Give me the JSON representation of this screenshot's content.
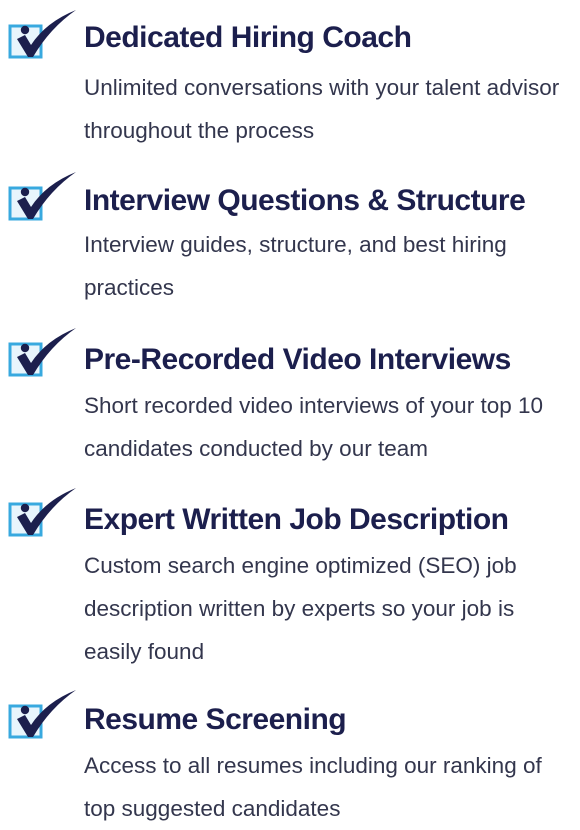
{
  "colors": {
    "title": "#1c1f4d",
    "body_text": "#33364d",
    "checkbox_border": "#38a9df",
    "checkbox_fill": "#e8f5fc",
    "checkmark": "#1c1f4d"
  },
  "icon": "checkbox-checkmark-icon",
  "features": [
    {
      "title": "Dedicated Hiring Coach",
      "description": "Unlimited conversations with your talent advisor throughout the process"
    },
    {
      "title": "Interview Questions & Structure",
      "description": "Interview guides, structure, and best hiring practices"
    },
    {
      "title": "Pre-Recorded Video Interviews",
      "description": "Short recorded video interviews of your top 10 candidates conducted by our team"
    },
    {
      "title": "Expert Written Job Description",
      "description": "Custom search engine optimized (SEO) job description written by experts so your job is easily found"
    },
    {
      "title": "Resume Screening",
      "description": "Access to all resumes including our ranking of top suggested candidates"
    }
  ]
}
